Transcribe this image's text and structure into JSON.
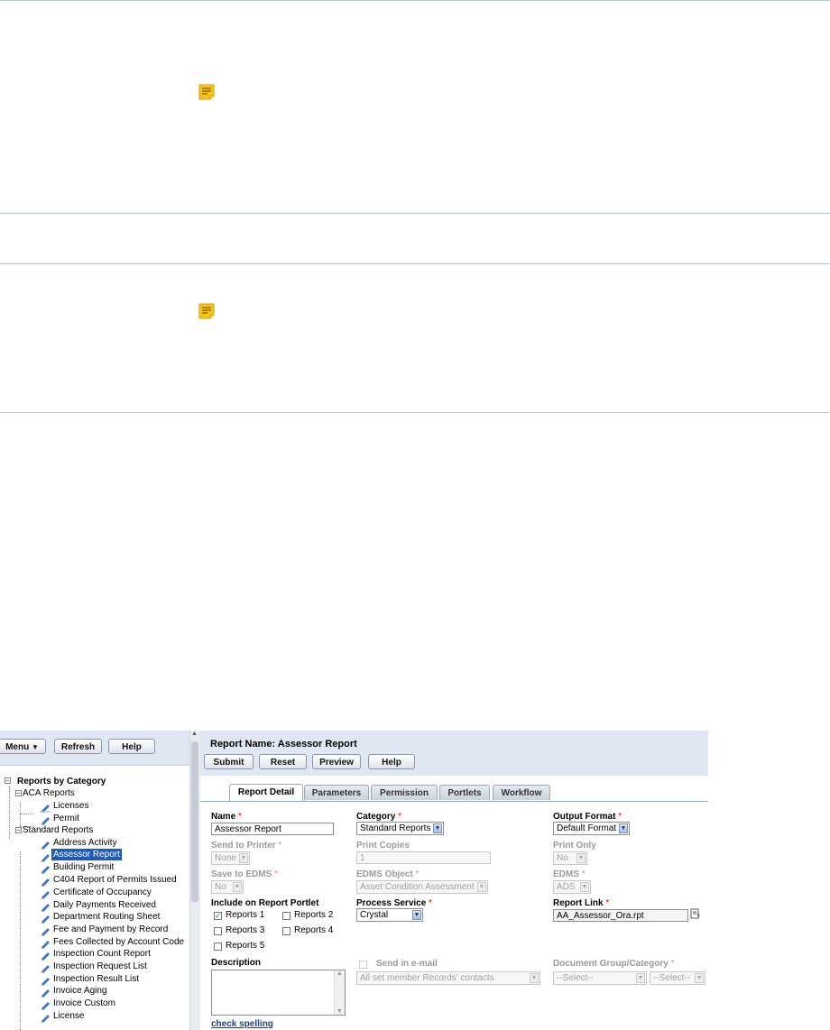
{
  "document": {
    "note_icon_1": "note-icon",
    "note_icon_2": "note-icon"
  },
  "toolbar": {
    "menu_label": "Menu",
    "refresh_label": "Refresh",
    "help_label": "Help"
  },
  "tree": {
    "root": "Reports by Category",
    "groups": [
      {
        "label": "ACA Reports",
        "items": [
          "Licenses",
          "Permit"
        ]
      },
      {
        "label": "Standard Reports",
        "items": [
          "Address Activity",
          "Assessor Report",
          "Building Permit",
          "C404 Report of Permits Issued",
          "Certificate of Occupancy",
          "Daily Payments Received",
          "Department Routing Sheet",
          "Fee and Payment by Record",
          "Fees Collected by Account Code",
          "Inspection Count Report",
          "Inspection Request List",
          "Inspection Result List",
          "Invoice Aging",
          "Invoice Custom",
          "License"
        ]
      }
    ],
    "selected": "Assessor Report"
  },
  "report": {
    "title": "Report Name: Assessor Report",
    "buttons": {
      "submit": "Submit",
      "reset": "Reset",
      "preview": "Preview",
      "help": "Help"
    },
    "tabs": [
      "Report Detail",
      "Parameters",
      "Permission",
      "Portlets",
      "Workflow"
    ],
    "active_tab": "Report Detail",
    "fields": {
      "name_label": "Name",
      "name_value": "Assessor Report",
      "category_label": "Category",
      "category_value": "Standard Reports",
      "output_format_label": "Output Format",
      "output_format_value": "Default Format",
      "send_to_printer_label": "Send to Printer",
      "send_to_printer_value": "None",
      "print_copies_label": "Print Copies",
      "print_copies_value": "1",
      "print_only_label": "Print Only",
      "print_only_value": "No",
      "save_to_edms_label": "Save to EDMS",
      "save_to_edms_value": "No",
      "edms_object_label": "EDMS Object",
      "edms_object_value": "Asset Condition Assessment",
      "edms_label": "EDMS",
      "edms_value": "ADS",
      "include_label": "Include on Report Portlet",
      "reports": [
        {
          "label": "Reports 1",
          "checked": true
        },
        {
          "label": "Reports 2",
          "checked": false
        },
        {
          "label": "Reports 3",
          "checked": false
        },
        {
          "label": "Reports 4",
          "checked": false
        },
        {
          "label": "Reports 5",
          "checked": false
        }
      ],
      "process_service_label": "Process Service",
      "process_service_value": "Crystal",
      "report_link_label": "Report Link",
      "report_link_value": "AA_Assessor_Ora.rpt",
      "description_label": "Description",
      "check_spelling": "check spelling",
      "send_email_label": "Send in e-mail",
      "send_email_value": "All set member Records' contacts",
      "doc_group_label": "Document Group/Category",
      "doc_group_value": "--Select--",
      "doc_category_value": "--Select--",
      "required_mark": "*"
    }
  },
  "colors": {
    "header_bg": "#dfe7f2",
    "link": "#15428b",
    "rule": "#b7c9ca",
    "selected_bg": "#1f5bb8"
  }
}
